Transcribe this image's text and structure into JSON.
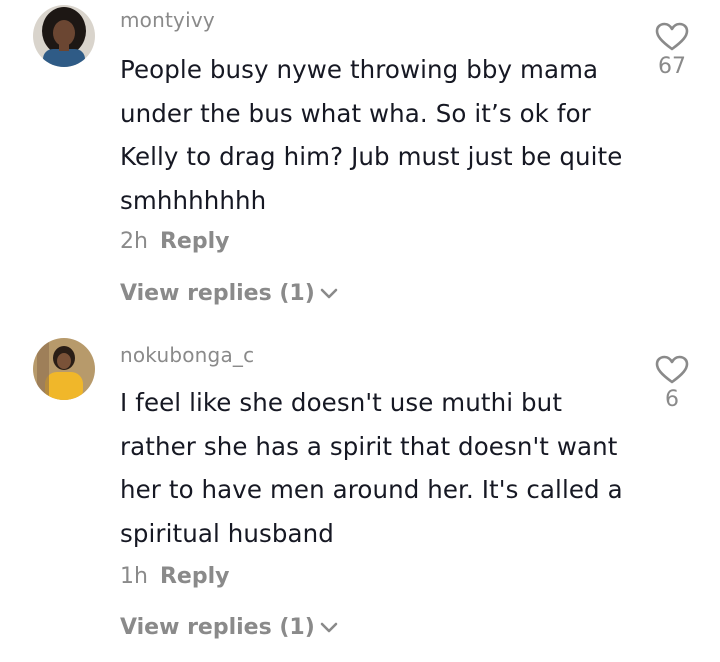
{
  "comments": [
    {
      "username": "montyivy",
      "text": "People busy nywe throwing bby mama under the bus what wha. So it’s ok for Kelly to drag him? Jub must just be quite smhhhhhhh",
      "time": "2h",
      "reply_label": "Reply",
      "view_replies": "View replies (1)",
      "likes": "67",
      "icons": {
        "like": "heart-outline-icon",
        "expand": "chevron-down-icon"
      }
    },
    {
      "username": "nokubonga_c",
      "text": "I feel like she doesn't use muthi but rather she has a spirit that doesn't want her to have men around her. It's called a spiritual husband",
      "time": "1h",
      "reply_label": "Reply",
      "view_replies": "View replies (1)",
      "likes": "6",
      "icons": {
        "like": "heart-outline-icon",
        "expand": "chevron-down-icon"
      }
    }
  ],
  "colors": {
    "text_primary": "#161823",
    "text_secondary": "#8a8a8a",
    "background": "#ffffff"
  }
}
